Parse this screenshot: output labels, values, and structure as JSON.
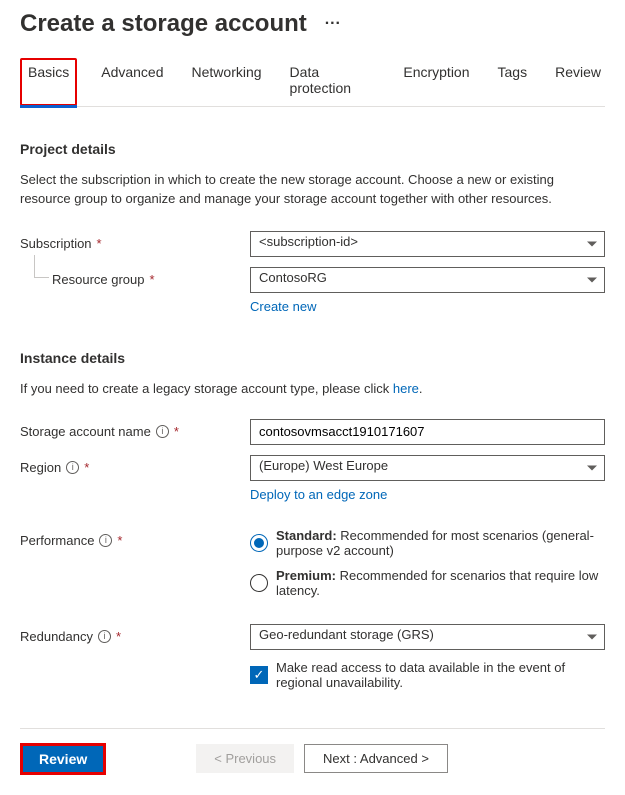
{
  "page": {
    "title": "Create a storage account"
  },
  "tabs": [
    {
      "label": "Basics",
      "active": true
    },
    {
      "label": "Advanced"
    },
    {
      "label": "Networking"
    },
    {
      "label": "Data protection"
    },
    {
      "label": "Encryption"
    },
    {
      "label": "Tags"
    },
    {
      "label": "Review"
    }
  ],
  "project": {
    "heading": "Project details",
    "description": "Select the subscription in which to create the new storage account. Choose a new or existing resource group to organize and manage your storage account together with other resources.",
    "subscription_label": "Subscription",
    "subscription_value": "<subscription-id>",
    "rg_label": "Resource group",
    "rg_value": "ContosoRG",
    "create_new": "Create new"
  },
  "instance": {
    "heading": "Instance details",
    "desc_prefix": "If you need to create a legacy storage account type, please click ",
    "desc_link": "here",
    "desc_suffix": ".",
    "name_label": "Storage account name",
    "name_value": "contosovmsacct1910171607",
    "region_label": "Region",
    "region_value": "(Europe) West Europe",
    "edge_zone": "Deploy to an edge zone",
    "perf_label": "Performance",
    "perf_standard_bold": "Standard:",
    "perf_standard_rest": " Recommended for most scenarios (general-purpose v2 account)",
    "perf_premium_bold": "Premium:",
    "perf_premium_rest": " Recommended for scenarios that require low latency.",
    "redund_label": "Redundancy",
    "redund_value": "Geo-redundant storage (GRS)",
    "redund_check": "Make read access to data available in the event of regional unavailability."
  },
  "footer": {
    "review": "Review",
    "previous": "< Previous",
    "next": "Next : Advanced >"
  }
}
